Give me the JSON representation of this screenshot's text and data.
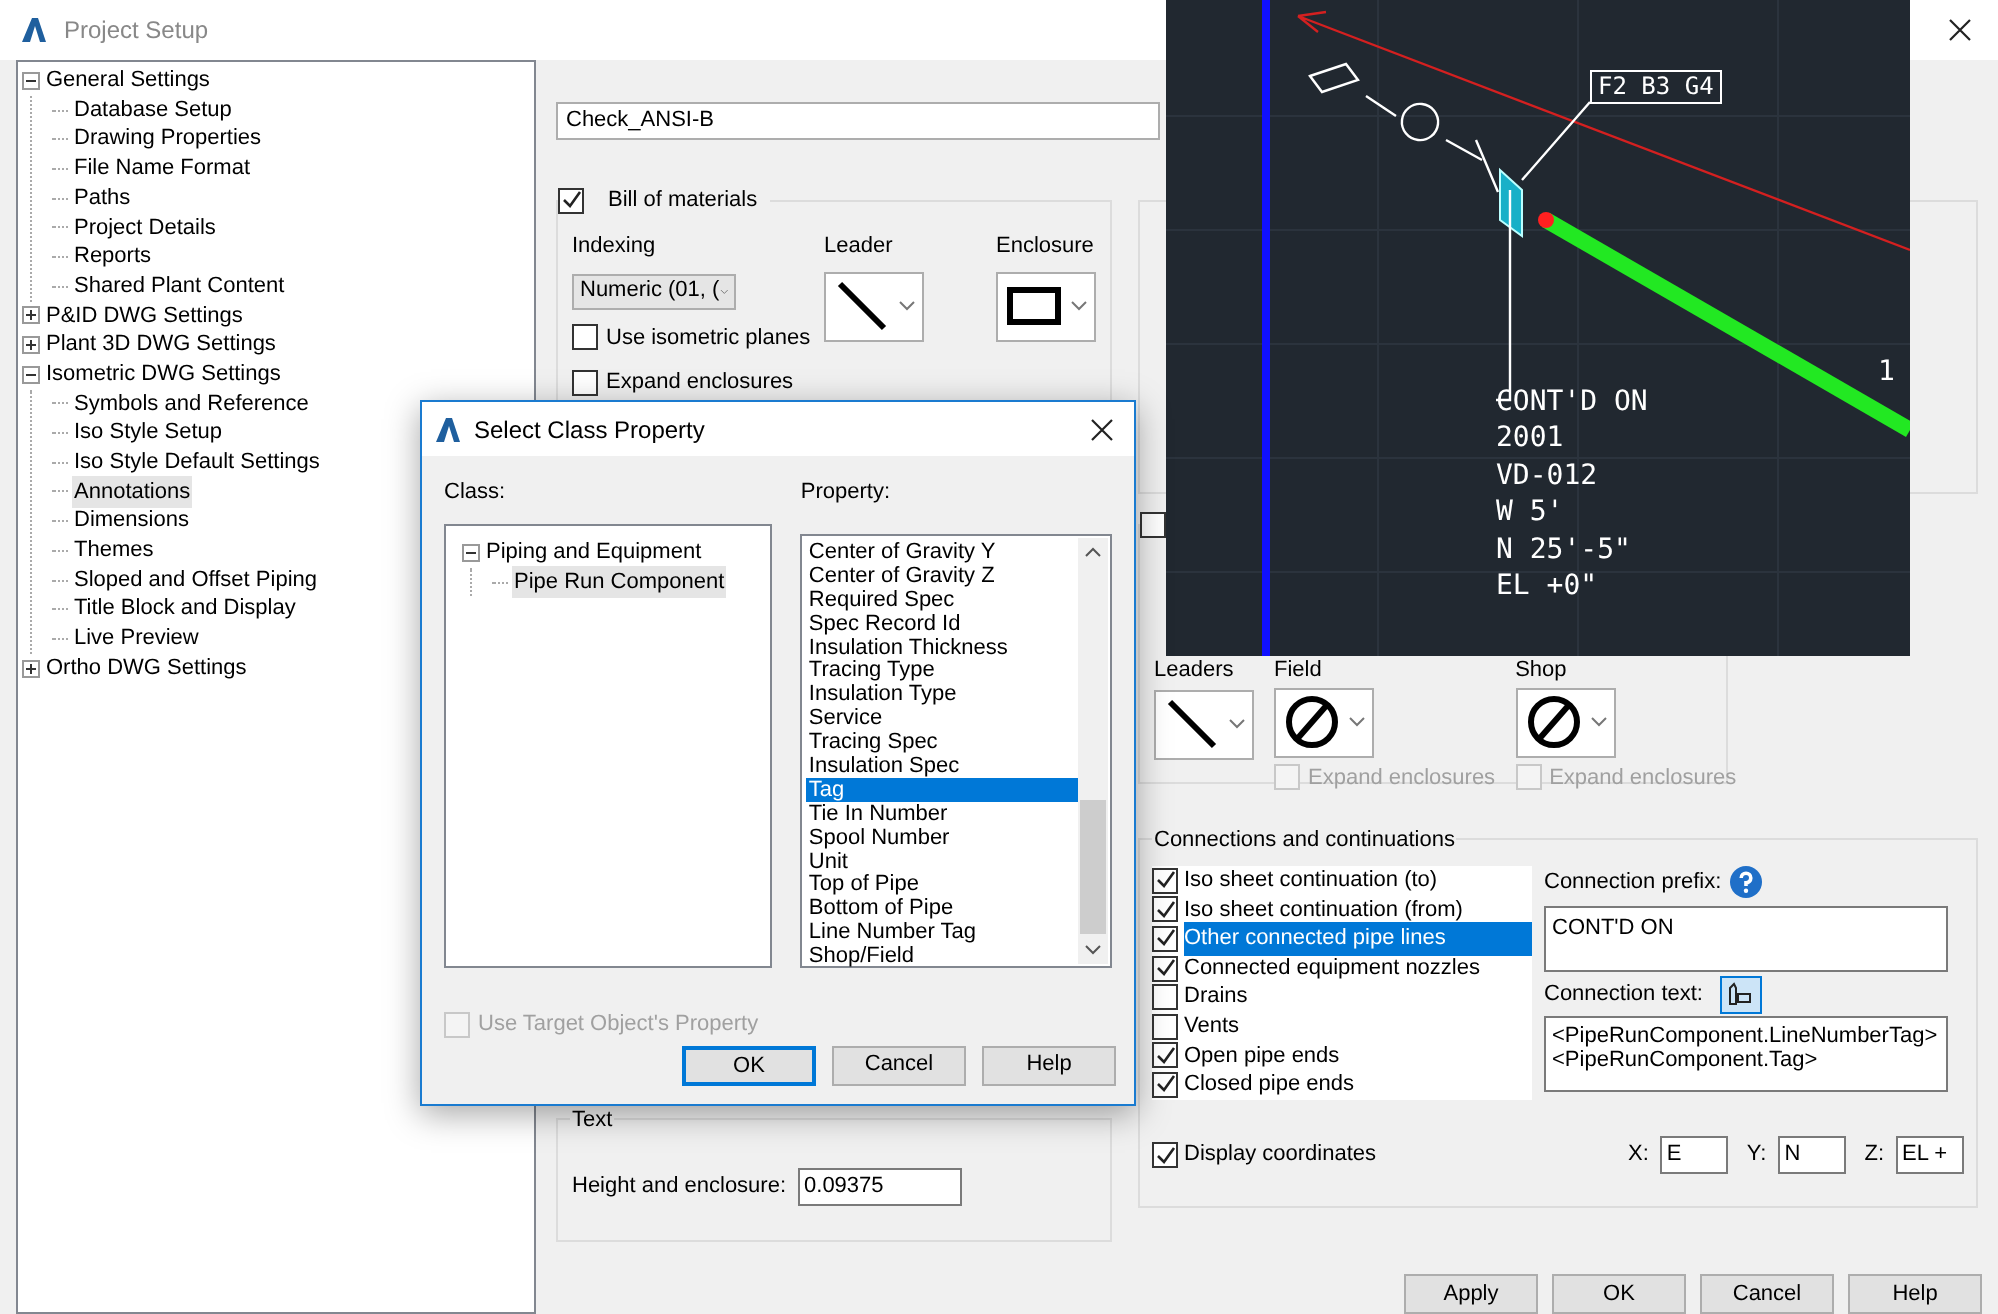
{
  "window": {
    "title": "Project Setup"
  },
  "tree": [
    {
      "label": "General Settings",
      "expanded": true,
      "selected": false,
      "children": [
        {
          "label": "Database Setup",
          "selected": false
        },
        {
          "label": "Drawing Properties",
          "selected": false
        },
        {
          "label": "File Name Format",
          "selected": false
        },
        {
          "label": "Paths",
          "selected": false
        },
        {
          "label": "Project Details",
          "selected": false
        },
        {
          "label": "Reports",
          "selected": false
        },
        {
          "label": "Shared Plant Content",
          "selected": false
        }
      ]
    },
    {
      "label": "P&ID DWG Settings",
      "expanded": false,
      "selected": false
    },
    {
      "label": "Plant 3D DWG Settings",
      "expanded": false,
      "selected": false
    },
    {
      "label": "Isometric DWG Settings",
      "expanded": true,
      "selected": false,
      "children": [
        {
          "label": "Symbols and Reference",
          "selected": false
        },
        {
          "label": "Iso Style Setup",
          "selected": false
        },
        {
          "label": "Iso Style Default Settings",
          "selected": false
        },
        {
          "label": "Annotations",
          "selected": true
        },
        {
          "label": "Dimensions",
          "selected": false
        },
        {
          "label": "Themes",
          "selected": false
        },
        {
          "label": "Sloped and Offset Piping",
          "selected": false
        },
        {
          "label": "Title Block and Display",
          "selected": false
        },
        {
          "label": "Live Preview",
          "selected": false
        }
      ]
    },
    {
      "label": "Ortho DWG Settings",
      "expanded": false,
      "selected": false
    }
  ],
  "style_name": {
    "value": "Check_ANSI-B"
  },
  "bill_of_materials": {
    "label": "Bill of materials",
    "checked": true,
    "indexing_label": "Indexing",
    "indexing_value": "Numeric (01, (",
    "leader_label": "Leader",
    "enclosure_label": "Enclosure",
    "options": [
      {
        "label": "Use isometric planes",
        "checked": false
      },
      {
        "label": "Expand enclosures",
        "checked": false
      }
    ]
  },
  "text_group": {
    "title": "Text",
    "height_label": "Height and enclosure:",
    "height_value": "0.09375"
  },
  "symbols": {
    "checked": false,
    "leaders_label": "Leaders",
    "styles": [
      {
        "label": "Field",
        "expand_label": "Expand enclosures",
        "expand_checked": false,
        "disabled": true
      },
      {
        "label": "Shop",
        "expand_label": "Expand enclosures",
        "expand_checked": false,
        "disabled": true
      }
    ]
  },
  "connections": {
    "title": "Connections and continuations",
    "items": [
      {
        "label": "Iso sheet continuation (to)",
        "checked": true,
        "selected": false
      },
      {
        "label": "Iso sheet continuation (from)",
        "checked": true,
        "selected": false
      },
      {
        "label": "Other connected pipe lines",
        "checked": true,
        "selected": true
      },
      {
        "label": "Connected equipment nozzles",
        "checked": true,
        "selected": false
      },
      {
        "label": "Drains",
        "checked": false,
        "selected": false
      },
      {
        "label": "Vents",
        "checked": false,
        "selected": false
      },
      {
        "label": "Open pipe ends",
        "checked": true,
        "selected": false
      },
      {
        "label": "Closed pipe ends",
        "checked": true,
        "selected": false
      }
    ],
    "prefix_label": "Connection prefix:",
    "prefix_value": "CONT'D ON",
    "text_label": "Connection text:",
    "text_lines": [
      "<PipeRunComponent.LineNumberTag>",
      "<PipeRunComponent.Tag>"
    ],
    "display_coordinates": {
      "label": "Display coordinates",
      "checked": true
    },
    "coords": [
      {
        "label": "X:",
        "value": "E"
      },
      {
        "label": "Y:",
        "value": "N"
      },
      {
        "label": "Z:",
        "value": "EL +"
      }
    ]
  },
  "buttons": [
    "Apply",
    "OK",
    "Cancel",
    "Help"
  ],
  "cad_preview": {
    "tag": "F2 B3 G4",
    "lines": [
      "CONT'D ON",
      "2001",
      "VD-012",
      "W 5'",
      "N 25'-5\"",
      "EL +0\""
    ],
    "cut_label": "1"
  },
  "select_dialog": {
    "title": "Select Class Property",
    "class_label": "Class:",
    "class_tree": [
      {
        "label": "Piping and Equipment",
        "expanded": true,
        "selected": false,
        "children": [
          {
            "label": "Pipe Run Component",
            "selected": true
          }
        ]
      }
    ],
    "property_label": "Property:",
    "properties": [
      {
        "label": "Center of Gravity Y",
        "selected": false
      },
      {
        "label": "Center of Gravity Z",
        "selected": false
      },
      {
        "label": "Required Spec",
        "selected": false
      },
      {
        "label": "Spec Record Id",
        "selected": false
      },
      {
        "label": "Insulation Thickness",
        "selected": false
      },
      {
        "label": "Tracing Type",
        "selected": false
      },
      {
        "label": "Insulation Type",
        "selected": false
      },
      {
        "label": "Service",
        "selected": false
      },
      {
        "label": "Tracing Spec",
        "selected": false
      },
      {
        "label": "Insulation Spec",
        "selected": false
      },
      {
        "label": "Tag",
        "selected": true
      },
      {
        "label": "Tie In Number",
        "selected": false
      },
      {
        "label": "Spool Number",
        "selected": false
      },
      {
        "label": "Unit",
        "selected": false
      },
      {
        "label": "Top of Pipe",
        "selected": false
      },
      {
        "label": "Bottom of Pipe",
        "selected": false
      },
      {
        "label": "Line Number Tag",
        "selected": false
      },
      {
        "label": "Shop/Field",
        "selected": false
      }
    ],
    "use_target": {
      "label": "Use Target Object's Property",
      "checked": false,
      "disabled": true
    },
    "buttons": [
      {
        "label": "OK",
        "default": true
      },
      {
        "label": "Cancel",
        "default": false
      },
      {
        "label": "Help",
        "default": false
      }
    ]
  }
}
